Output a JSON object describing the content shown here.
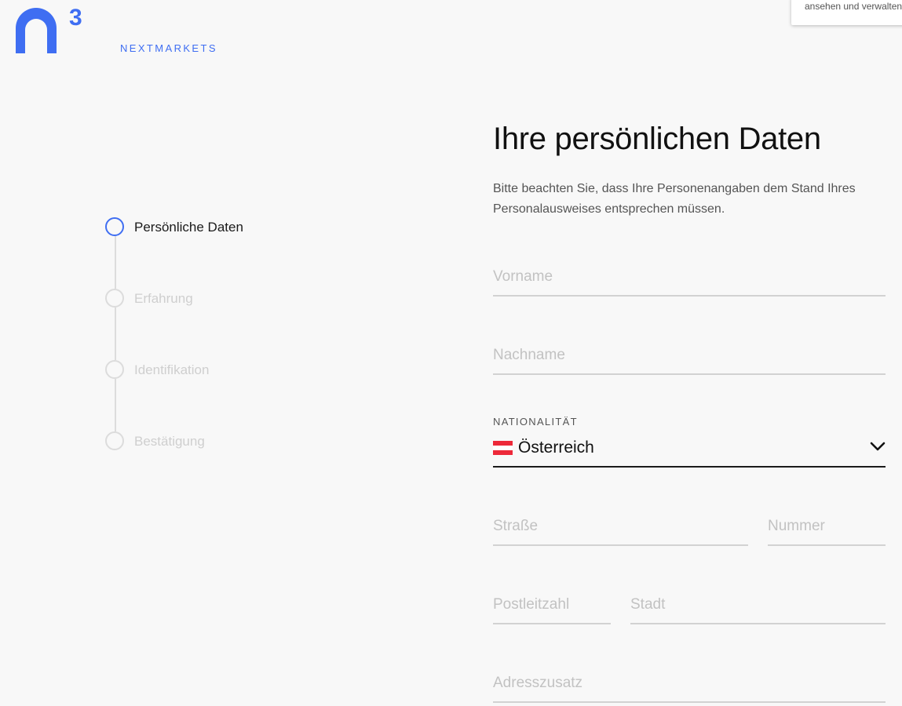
{
  "brand": {
    "superscript": "3",
    "name": "NEXTMARKETS",
    "color": "#3f6ef2"
  },
  "notice": {
    "text": "ansehen und verwalten"
  },
  "stepper": {
    "steps": [
      {
        "label": "Persönliche Daten",
        "state": "active"
      },
      {
        "label": "Erfahrung",
        "state": "inactive"
      },
      {
        "label": "Identifikation",
        "state": "inactive"
      },
      {
        "label": "Bestätigung",
        "state": "inactive"
      }
    ]
  },
  "form": {
    "title": "Ihre persönlichen Daten",
    "intro": "Bitte beachten Sie, dass Ihre Personenangaben dem Stand Ihres Personalausweises entsprechen müssen.",
    "fields": {
      "first_name": {
        "placeholder": "Vorname",
        "value": ""
      },
      "last_name": {
        "placeholder": "Nachname",
        "value": ""
      },
      "street": {
        "placeholder": "Straße",
        "value": ""
      },
      "number": {
        "placeholder": "Nummer",
        "value": ""
      },
      "postal_code": {
        "placeholder": "Postleitzahl",
        "value": ""
      },
      "city": {
        "placeholder": "Stadt",
        "value": ""
      },
      "address_extra": {
        "placeholder": "Adresszusatz",
        "value": ""
      }
    },
    "nationality": {
      "label": "NATIONALITÄT",
      "selected": "Österreich",
      "flag_icon": "austria-flag-icon",
      "flag_colors": [
        "#ed2939",
        "#ffffff",
        "#ed2939"
      ]
    }
  }
}
